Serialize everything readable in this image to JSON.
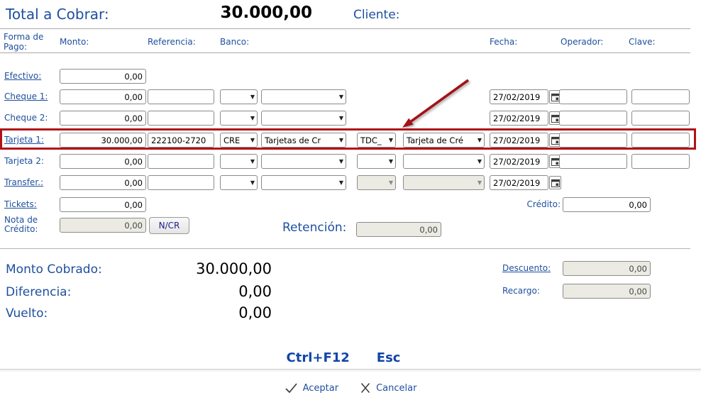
{
  "header": {
    "total_label": "Total a Cobrar:",
    "total_value": "30.000,00",
    "cliente_label": "Cliente:"
  },
  "columns": {
    "forma_de_pago": "Forma de Pago:",
    "monto": "Monto:",
    "referencia": "Referencia:",
    "banco": "Banco:",
    "fecha": "Fecha:",
    "operador": "Operador:",
    "clave": "Clave:"
  },
  "rows": {
    "efectivo": {
      "label": "Efectivo:",
      "monto": "0,00"
    },
    "cheque1": {
      "label": "Cheque 1:",
      "monto": "0,00",
      "referencia": "",
      "banco_code": "",
      "banco_name": "",
      "fecha": "27/02/2019",
      "operador": "",
      "clave": ""
    },
    "cheque2": {
      "label": "Cheque 2:",
      "monto": "0,00",
      "referencia": "",
      "banco_code": "",
      "banco_name": "",
      "fecha": "27/02/2019",
      "operador": "",
      "clave": ""
    },
    "tarjeta1": {
      "label": "Tarjeta 1:",
      "monto": "30.000,00",
      "referencia": "222100-2720",
      "banco_code": "CRE",
      "banco_name": "Tarjetas de Cr",
      "tdc_code": "TDC_",
      "tdc_name": "Tarjeta de Cré",
      "fecha": "27/02/2019",
      "operador": "",
      "clave": ""
    },
    "tarjeta2": {
      "label": "Tarjeta 2:",
      "monto": "0,00",
      "referencia": "",
      "banco_code": "",
      "banco_name": "",
      "tdc_code": "",
      "tdc_name": "",
      "fecha": "27/02/2019",
      "operador": "",
      "clave": ""
    },
    "transfer": {
      "label": "Transfer.:",
      "monto": "0,00",
      "referencia": "",
      "banco_code": "",
      "banco_name": "",
      "tdc_code": "",
      "tdc_name": "",
      "fecha": "27/02/2019"
    },
    "tickets": {
      "label": "Tickets:",
      "monto": "0,00"
    },
    "credito": {
      "label": "Crédito:",
      "value": "0,00"
    },
    "nota_credito": {
      "label_line1": "Nota de",
      "label_line2": "Crédito:",
      "monto": "0,00",
      "button_label": "N/CR"
    },
    "retencion": {
      "label": "Retención:",
      "value": "0,00"
    }
  },
  "summary": {
    "monto_cobrado_label": "Monto Cobrado:",
    "monto_cobrado_value": "30.000,00",
    "diferencia_label": "Diferencia:",
    "diferencia_value": "0,00",
    "vuelto_label": "Vuelto:",
    "vuelto_value": "0,00",
    "descuento_label": "Descuento:",
    "descuento_value": "0,00",
    "recargo_label": "Recargo:",
    "recargo_value": "0,00"
  },
  "footer": {
    "shortcut_accept": "Ctrl+F12",
    "shortcut_cancel": "Esc",
    "accept_label": "Aceptar",
    "cancel_label": "Cancelar"
  },
  "colors": {
    "label_blue": "#1d4f9e",
    "highlight_red": "#b11116",
    "disabled_bg": "#ebebe4"
  }
}
